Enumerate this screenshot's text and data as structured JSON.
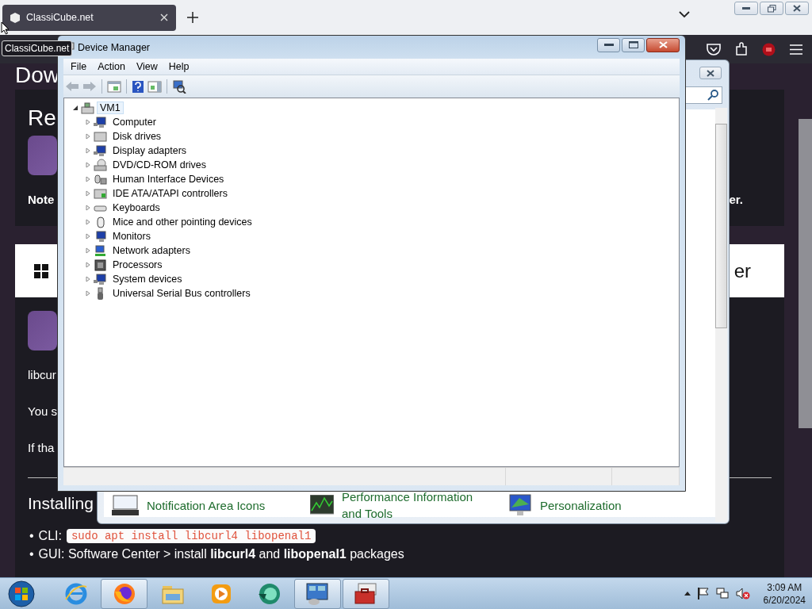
{
  "browser": {
    "tab": {
      "title": "ClassiCube.net",
      "selected": true
    },
    "tooltip": "ClassiCube.net",
    "page": {
      "heading": "Dow",
      "section_heading": "Re",
      "note": "Note",
      "note_end": "er.",
      "card_end": "er",
      "paragraphs": [
        "libcur",
        "You s",
        "If tha"
      ],
      "install_heading": "Installing",
      "list": [
        {
          "kind": "code",
          "marker": "•",
          "label": "CLI:",
          "code": "sudo apt install libcurl4 libopenal1"
        },
        {
          "kind": "text",
          "marker": "•",
          "text": "GUI: Software Center > install **libcurl4** and **libopenal1** packages"
        }
      ]
    }
  },
  "control_panel": {
    "items": [
      {
        "label": "Notification Area Icons"
      },
      {
        "label": "Performance Information and Tools"
      },
      {
        "label": "Personalization"
      }
    ]
  },
  "device_manager": {
    "title": "Device Manager",
    "menu": [
      "File",
      "Action",
      "View",
      "Help"
    ],
    "tree": {
      "label": "VM1",
      "expanded": true,
      "selected": true,
      "children": [
        {
          "label": "Computer",
          "expanded": false,
          "selected": false
        },
        {
          "label": "Disk drives",
          "expanded": false,
          "selected": false
        },
        {
          "label": "Display adapters",
          "expanded": false,
          "selected": false
        },
        {
          "label": "DVD/CD-ROM drives",
          "expanded": false,
          "selected": false
        },
        {
          "label": "Human Interface Devices",
          "expanded": false,
          "selected": false
        },
        {
          "label": "IDE ATA/ATAPI controllers",
          "expanded": false,
          "selected": false
        },
        {
          "label": "Keyboards",
          "expanded": false,
          "selected": false
        },
        {
          "label": "Mice and other pointing devices",
          "expanded": false,
          "selected": false
        },
        {
          "label": "Monitors",
          "expanded": false,
          "selected": false
        },
        {
          "label": "Network adapters",
          "expanded": false,
          "selected": false
        },
        {
          "label": "Processors",
          "expanded": false,
          "selected": false
        },
        {
          "label": "System devices",
          "expanded": false,
          "selected": false
        },
        {
          "label": "Universal Serial Bus controllers",
          "expanded": false,
          "selected": false
        }
      ]
    }
  },
  "taskbar": {
    "apps": [
      {
        "kind": "ie",
        "active": false
      },
      {
        "kind": "firefox",
        "active": true
      },
      {
        "kind": "explorer",
        "active": false
      },
      {
        "kind": "media",
        "active": false
      },
      {
        "kind": "green",
        "active": false
      },
      {
        "kind": "control",
        "active": true
      },
      {
        "kind": "toolbox",
        "active": true
      }
    ],
    "time": "3:09 AM",
    "date": "6/20/2024"
  }
}
